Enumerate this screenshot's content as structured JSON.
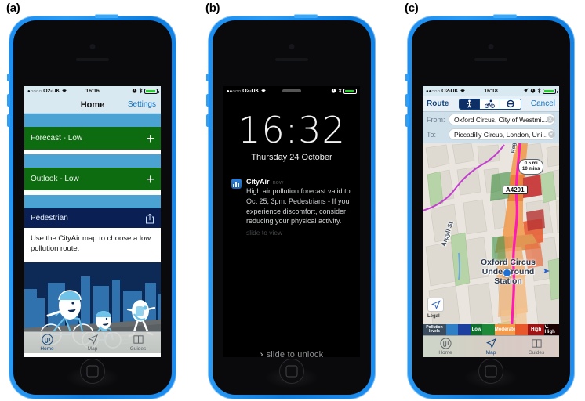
{
  "panels": {
    "a": "(a)",
    "b": "(b)",
    "c": "(c)"
  },
  "phone_a": {
    "status": {
      "dots": "●○○○○",
      "carrier": "O2-UK",
      "time": "16:16"
    },
    "navbar": {
      "title": "Home",
      "settings": "Settings"
    },
    "rows": [
      {
        "label": "Forecast - Low",
        "action": "+"
      },
      {
        "label": "Outlook - Low",
        "action": "+"
      }
    ],
    "pedestrian_row": {
      "label": "Pedestrian"
    },
    "message": "Use the CityAir map to choose a low pollution route.",
    "tabs": [
      {
        "label": "Home",
        "active": true
      },
      {
        "label": "Map",
        "active": false
      },
      {
        "label": "Guides",
        "active": false
      }
    ]
  },
  "phone_b": {
    "status": {
      "dots": "●●○○○",
      "carrier": "O2-UK"
    },
    "time": "16:32",
    "date": "Thursday 24 October",
    "notification": {
      "app": "CityAir",
      "when": "now",
      "body": "High air pollution forecast valid to Oct 25, 3pm. Pedestrians - If you experience discomfort, consider reducing your physical activity.",
      "slide_hint": "slide to view"
    },
    "unlock": "slide to unlock",
    "unlock_chevron": "›"
  },
  "phone_c": {
    "status": {
      "dots": "●●○○○",
      "carrier": "O2-UK",
      "time": "16:18"
    },
    "routebar": {
      "title": "Route",
      "cancel": "Cancel"
    },
    "modes": [
      {
        "name": "pedestrian",
        "selected": true
      },
      {
        "name": "cyclist",
        "selected": false
      },
      {
        "name": "underground",
        "selected": false
      }
    ],
    "fields": [
      {
        "label": "From:",
        "value": "Oxford Circus, City of Westmi..."
      },
      {
        "label": "To:",
        "value": "Piccadilly Circus, London, Uni..."
      }
    ],
    "map": {
      "distance_bubble": "0.5 mi\n10 mins",
      "distance_line1": "0.5 mi",
      "distance_line2": "10 mins",
      "road_shield": "A4201",
      "street_regent": "Regent St",
      "street_argyll": "Argyll St",
      "place_label_line1": "Oxford Circus",
      "place_label_line2": "Underground",
      "place_label_line3": "Station",
      "legal": "Legal"
    },
    "legend": {
      "key_line1": "Pollution",
      "key_line2": "levels",
      "segments": [
        {
          "label": "",
          "color": "#2f7fc6"
        },
        {
          "label": "",
          "color": "#1d3fa0"
        },
        {
          "label": "Low",
          "color": "#0f6d2d"
        },
        {
          "label": "",
          "color": "#1d8a3a"
        },
        {
          "label": "Moderate",
          "color": "#f2994a"
        },
        {
          "label": "",
          "color": "#e8582a"
        },
        {
          "label": "High",
          "color": "#9e1313"
        },
        {
          "label": "V. High",
          "color": "#1a0000"
        }
      ]
    },
    "tabs": [
      {
        "label": "Home",
        "active": false
      },
      {
        "label": "Map",
        "active": true
      },
      {
        "label": "Guides",
        "active": false
      }
    ]
  },
  "colors": {
    "phone_body": "#1e8ff2",
    "row_green": "#0d6b10",
    "row_navy": "#0a2054",
    "band_blue": "#4ba3d3",
    "nav_bg": "#d8e9f2",
    "link": "#1373c4",
    "route_line": "#ff19b5"
  }
}
